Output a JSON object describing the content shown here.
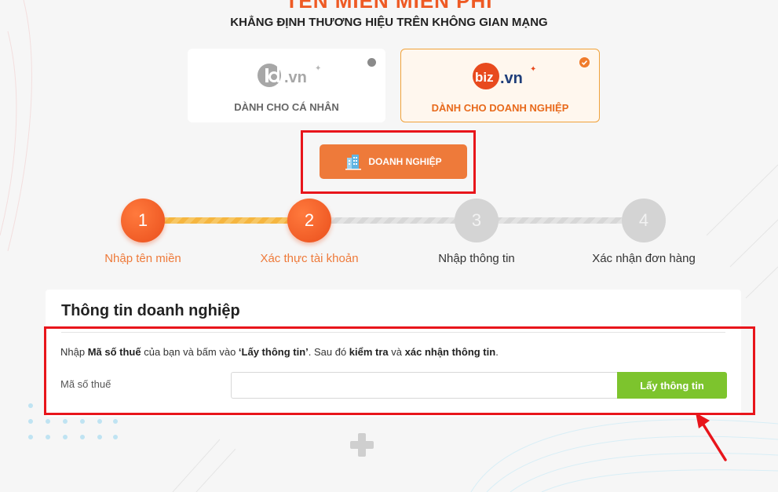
{
  "header": {
    "cut_title": "TÊN MIỀN MIỄN PHÍ",
    "subtitle": "KHẲNG ĐỊNH THƯƠNG HIỆU TRÊN KHÔNG GIAN MẠNG"
  },
  "cards": [
    {
      "logo_main": "id",
      "logo_suffix": ".vn",
      "label": "DÀNH CHO CÁ NHÂN",
      "selected": false
    },
    {
      "logo_main": "biz",
      "logo_suffix": ".vn",
      "label": "DÀNH CHO DOANH NGHIỆP",
      "selected": true
    }
  ],
  "business_button": {
    "label": "DOANH NGHIỆP",
    "icon": "building-icon"
  },
  "steps": [
    {
      "number": "1",
      "label": "Nhập tên miền",
      "state": "done"
    },
    {
      "number": "2",
      "label": "Xác thực tài khoản",
      "state": "current"
    },
    {
      "number": "3",
      "label": "Nhập thông tin",
      "state": "todo"
    },
    {
      "number": "4",
      "label": "Xác nhận đơn hàng",
      "state": "todo"
    }
  ],
  "panel": {
    "title": "Thông tin doanh nghiệp",
    "instruction": {
      "p1": "Nhập ",
      "b1": "Mã số thuế",
      "p2": " của bạn và bấm vào ",
      "b2": "‘Lấy thông tin’",
      "p3": ". Sau đó ",
      "b3": "kiểm tra",
      "p4": " và ",
      "b4": "xác nhận thông tin",
      "p5": "."
    },
    "tax_label": "Mã số thuế",
    "tax_value": "",
    "tax_placeholder": "",
    "get_info_button": "Lấy thông tin"
  },
  "colors": {
    "accent_orange": "#ee7a3a",
    "accent_green": "#7dc42d",
    "highlight_red": "#e8151b",
    "step_inactive": "#d4d4d4"
  }
}
